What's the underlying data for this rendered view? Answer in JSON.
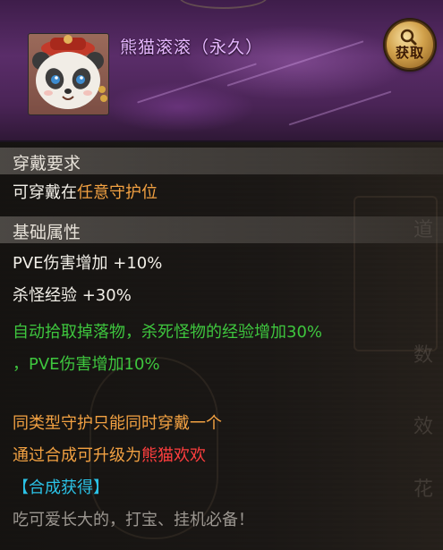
{
  "item": {
    "title": "熊猫滚滚（永久）",
    "obtain_label": "获取"
  },
  "wear_section": {
    "header": "穿戴要求",
    "prefix": "可穿戴在",
    "slot": "任意守护位"
  },
  "attr_section": {
    "header": "基础属性",
    "attributes": [
      "PVE伤害增加 +10%",
      "杀怪经验 +30%"
    ]
  },
  "special_effect": {
    "line1": "自动拾取掉落物，杀死怪物的经验增加30%",
    "line2": "，PVE伤害增加10%"
  },
  "notes": {
    "limit": "同类型守护只能同时穿戴一个",
    "upgrade_prefix": "通过合成可升级为",
    "upgrade_target": "熊猫欢欢",
    "source": "【合成获得】",
    "flavor": "吃可爱长大的，打宝、挂机必备！"
  },
  "colors": {
    "title": "#e6b7ff",
    "highlight": "#f2a142",
    "effect": "#3ec63e",
    "upgrade": "#ff3e3e",
    "source": "#2bc2e6",
    "flavor": "#9b9690"
  }
}
